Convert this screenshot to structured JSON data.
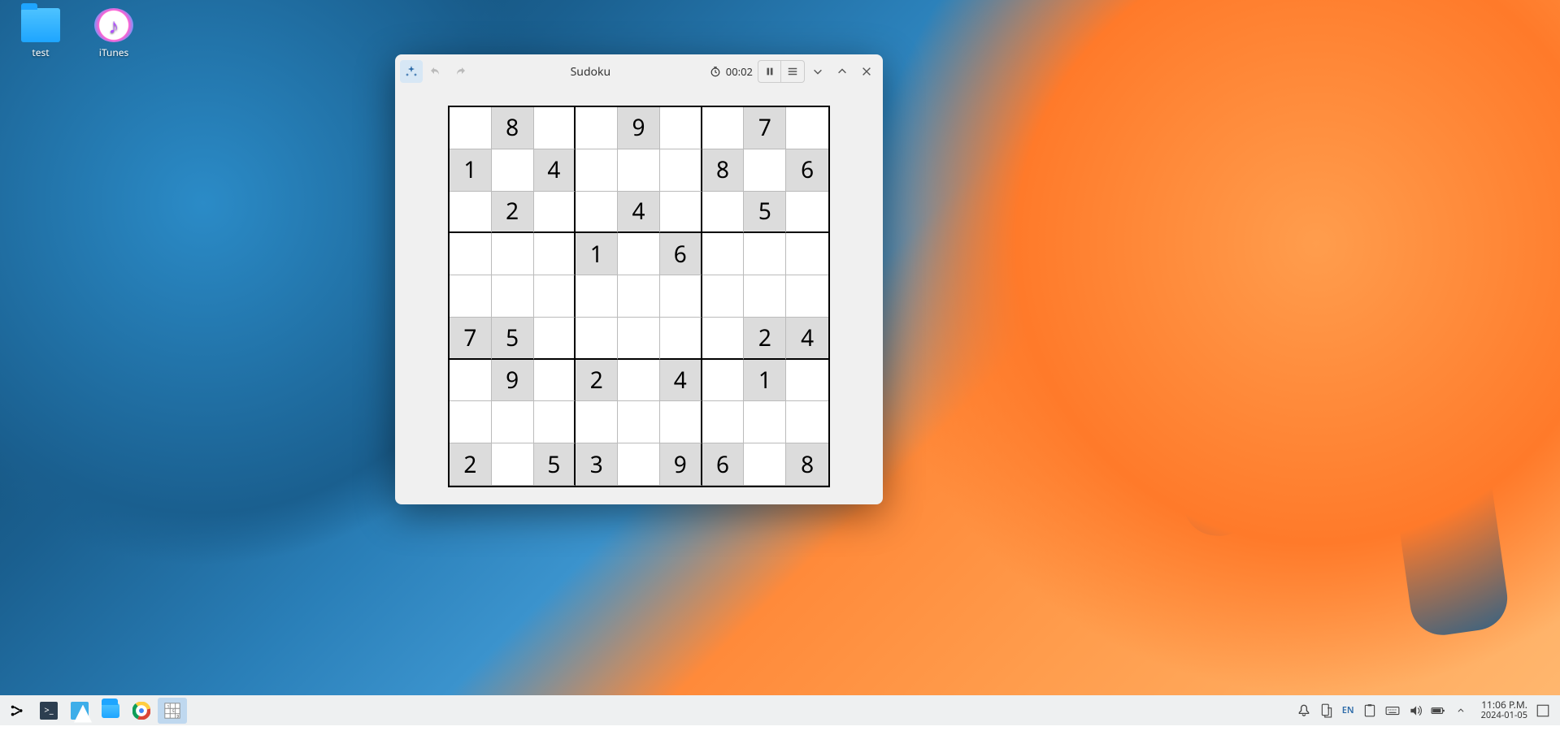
{
  "desktop_icons": [
    {
      "name": "test",
      "label": "test",
      "kind": "folder"
    },
    {
      "name": "itunes",
      "label": "iTunes",
      "kind": "itunes"
    }
  ],
  "window": {
    "title": "Sudoku",
    "timer": "00:02",
    "sudoku": {
      "grid": [
        [
          "",
          "8",
          "",
          "",
          "9",
          "",
          "",
          "7",
          ""
        ],
        [
          "1",
          "",
          "4",
          "",
          "",
          "",
          "8",
          "",
          "6"
        ],
        [
          "",
          "2",
          "",
          "",
          "4",
          "",
          "",
          "5",
          ""
        ],
        [
          "",
          "",
          "",
          "1",
          "",
          "6",
          "",
          "",
          ""
        ],
        [
          "",
          "",
          "",
          "",
          "",
          "",
          "",
          "",
          ""
        ],
        [
          "7",
          "5",
          "",
          "",
          "",
          "",
          "",
          "2",
          "4"
        ],
        [
          "",
          "9",
          "",
          "2",
          "",
          "4",
          "",
          "1",
          ""
        ],
        [
          "",
          "",
          "",
          "",
          "",
          "",
          "",
          "",
          ""
        ],
        [
          "2",
          "",
          "5",
          "3",
          "",
          "9",
          "6",
          "",
          "8"
        ]
      ]
    }
  },
  "taskbar": {
    "lang": "EN",
    "time": "11:06 P.M.",
    "date": "2024-01-05"
  }
}
